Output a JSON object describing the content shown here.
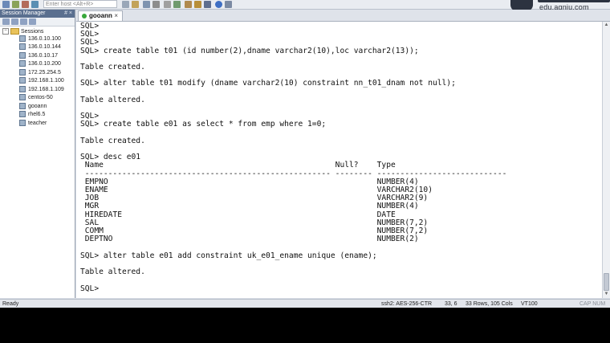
{
  "toolbar": {
    "host_placeholder": "Enter host <Alt+R>"
  },
  "watermark": {
    "url": "edu.aqniu.com"
  },
  "session_manager": {
    "title": "Session Manager",
    "header_buttons": "# ×",
    "root_label": "Sessions",
    "items": [
      "136.0.10.100",
      "136.0.10.144",
      "136.0.10.17",
      "136.0.10.200",
      "172.25.254.5",
      "192.168.1.100",
      "192.168.1.109",
      "centos-50",
      "gooann",
      "rhel6.5",
      "teacher"
    ]
  },
  "tab": {
    "label": "gooann",
    "close": "×"
  },
  "terminal": {
    "text": "SQL>\nSQL>\nSQL>\nSQL> create table t01 (id number(2),dname varchar2(10),loc varchar2(13));\n\nTable created.\n\nSQL> alter table t01 modify (dname varchar2(10) constraint nn_t01_dnam not null);\n\nTable altered.\n\nSQL>\nSQL> create table e01 as select * from emp where 1=0;\n\nTable created.\n\nSQL> desc e01\n Name                                                  Null?    Type\n ----------------------------------------------------- -------- ----------------------------\n EMPNO                                                          NUMBER(4)\n ENAME                                                          VARCHAR2(10)\n JOB                                                            VARCHAR2(9)\n MGR                                                            NUMBER(4)\n HIREDATE                                                       DATE\n SAL                                                            NUMBER(7,2)\n COMM                                                           NUMBER(7,2)\n DEPTNO                                                         NUMBER(2)\n\nSQL> alter table e01 add constraint uk_e01_ename unique (ename);\n\nTable altered.\n\nSQL>"
  },
  "statusbar": {
    "ready": "Ready",
    "cipher": "ssh2: AES-256-CTR",
    "cursor": "33,   6",
    "size": "33 Rows, 105 Cols",
    "emulation": "VT100",
    "caps": "CAP  NUM"
  },
  "colors": {
    "session_header_bg": "#5a6f8f",
    "terminal_bg": "#ffffff",
    "status_green": "#38a83a"
  }
}
